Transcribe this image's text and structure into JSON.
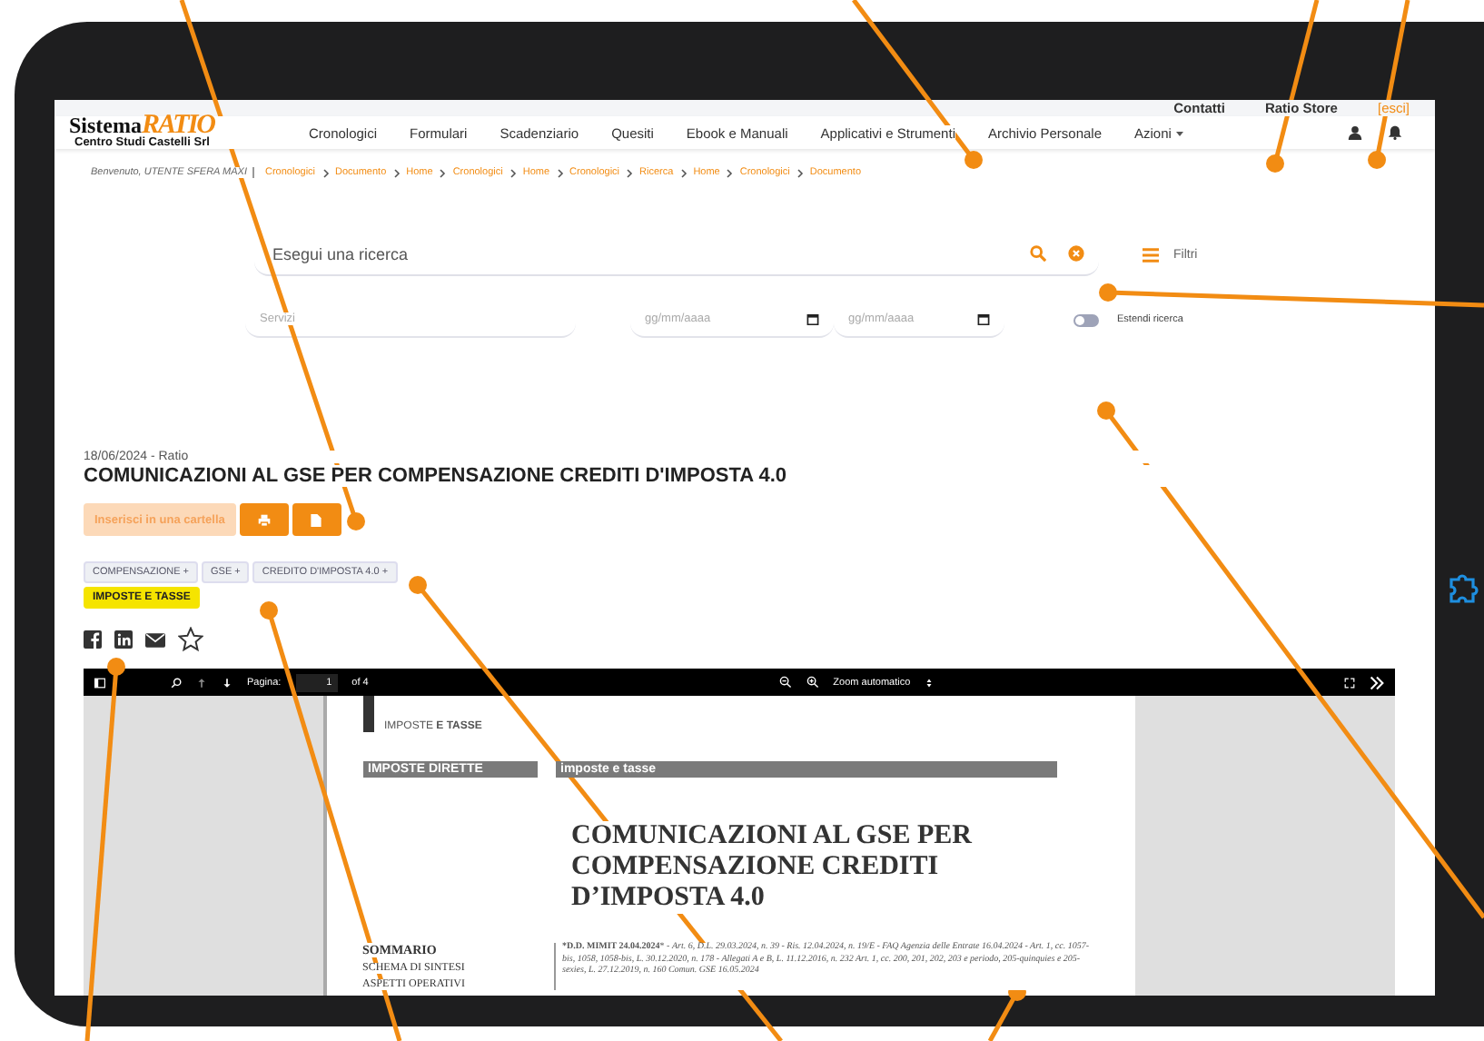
{
  "top_links": [
    {
      "label": "Contatti"
    },
    {
      "label": "Ratio Store"
    }
  ],
  "logout": "[esci]",
  "logo": {
    "word": "Sistema",
    "brand": "RATIO",
    "subtitle": "Centro Studi Castelli Srl"
  },
  "nav": [
    {
      "label": "Cronologici",
      "kind": "link"
    },
    {
      "label": "Formulari",
      "kind": "link"
    },
    {
      "label": "Scadenziario",
      "kind": "link"
    },
    {
      "label": "Quesiti",
      "kind": "link"
    },
    {
      "label": "Ebook e Manuali",
      "kind": "link"
    },
    {
      "label": "Applicativi e Strumenti",
      "kind": "link"
    },
    {
      "label": "Archivio Personale",
      "kind": "link"
    },
    {
      "label": "Azioni",
      "kind": "dropdown"
    }
  ],
  "welcome": "Benvenuto, UTENTE SFERA MAXI",
  "breadcrumb": [
    "Cronologici",
    "Documento",
    "Home",
    "Cronologici",
    "Home",
    "Cronologici",
    "Ricerca",
    "Home",
    "Cronologici",
    "Documento"
  ],
  "search": {
    "placeholder": "Esegui una ricerca",
    "filters_label": "Filtri"
  },
  "filters": {
    "service_placeholder": "Servizi",
    "date_from_placeholder": "gg/mm/aaaa",
    "date_to_placeholder": "gg/mm/aaaa",
    "extend": {
      "label": "Estendi ricerca",
      "on": false
    }
  },
  "document": {
    "meta": "18/06/2024 - Ratio",
    "title": "COMUNICAZIONI AL GSE PER COMPENSAZIONE CREDITI D'IMPOSTA 4.0",
    "folder_button": "Inserisci in una cartella",
    "tags": [
      {
        "label": "COMPENSAZIONE +",
        "kind": "keyword"
      },
      {
        "label": "GSE +",
        "kind": "keyword"
      },
      {
        "label": "CREDITO D'IMPOSTA 4.0 +",
        "kind": "keyword"
      },
      {
        "label": "IMPOSTE E TASSE",
        "kind": "category"
      }
    ],
    "favorite": false
  },
  "viewer": {
    "page_label": "Pagina:",
    "page": "1",
    "page_count": "of 4",
    "zoom": "Zoom automatico"
  },
  "pdf_page": {
    "header": "IMPOSTE **E TASSE**",
    "section": "IMPOSTE DIRETTE",
    "subject": "imposte e tasse",
    "title": "COMUNICAZIONI AL GSE PER COMPENSAZIONE CREDITI D’IMPOSTA 4.0",
    "summary_title": "SOMMARIO",
    "summary": [
      "SCHEMA DI SINTESI",
      "ASPETTI OPERATIVI"
    ],
    "references": "***D.D. MIMIT 24.04.2024*** - *Art. 6, D.L. 29.03.2024, n. 39 - Ris. 12.04.2024, n. 19/E - FAQ Agenzia delle Entrate 16.04.2024 - Art. 1, cc. 1057-bis, 1058, 1058-bis, L. 30.12.2020, n. 178 - Allegati A e B, L. 11.12.2016, n. 232 Art. 1, cc. 200, 201, 202, 203 e periodo, 205-quinquies e 205-sexies, L. 27.12.2019, n. 160 Comun. GSE 16.05.2024*"
  }
}
